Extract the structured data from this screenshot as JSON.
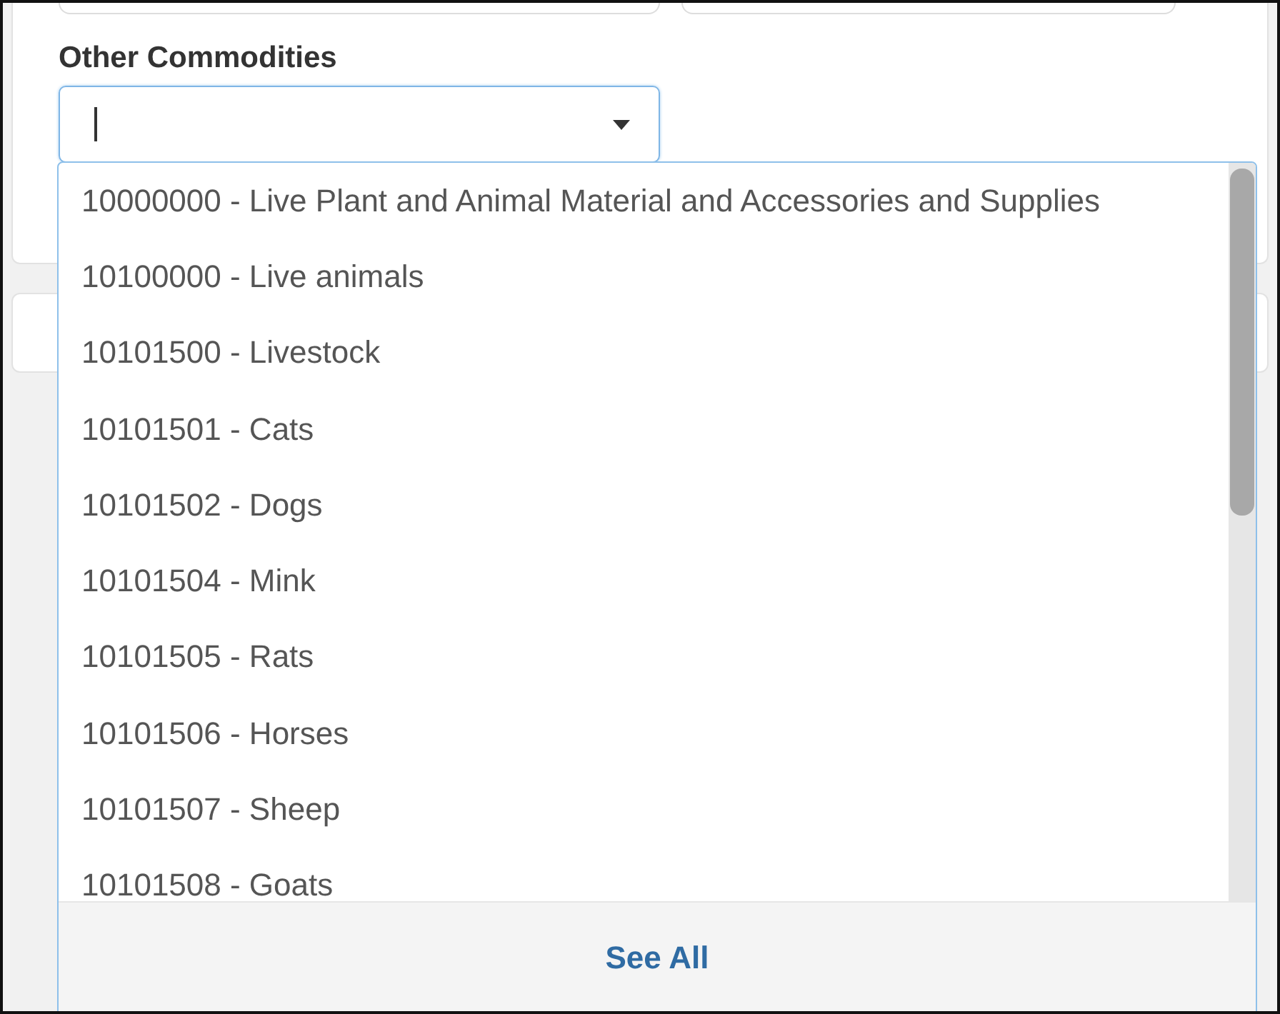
{
  "field_label": "Other Commodities",
  "dropdown": {
    "open": true,
    "options": [
      {
        "label": "10000000 - Live Plant and Animal Material and Accessories and Supplies"
      },
      {
        "label": "10100000 - Live animals"
      },
      {
        "label": "10101500 - Livestock"
      },
      {
        "label": "10101501 - Cats"
      },
      {
        "label": "10101502 - Dogs"
      },
      {
        "label": "10101504 - Mink"
      },
      {
        "label": "10101505 - Rats"
      },
      {
        "label": "10101506 - Horses"
      },
      {
        "label": "10101507 - Sheep"
      },
      {
        "label": "10101508 - Goats"
      }
    ],
    "footer_button": "See All"
  }
}
